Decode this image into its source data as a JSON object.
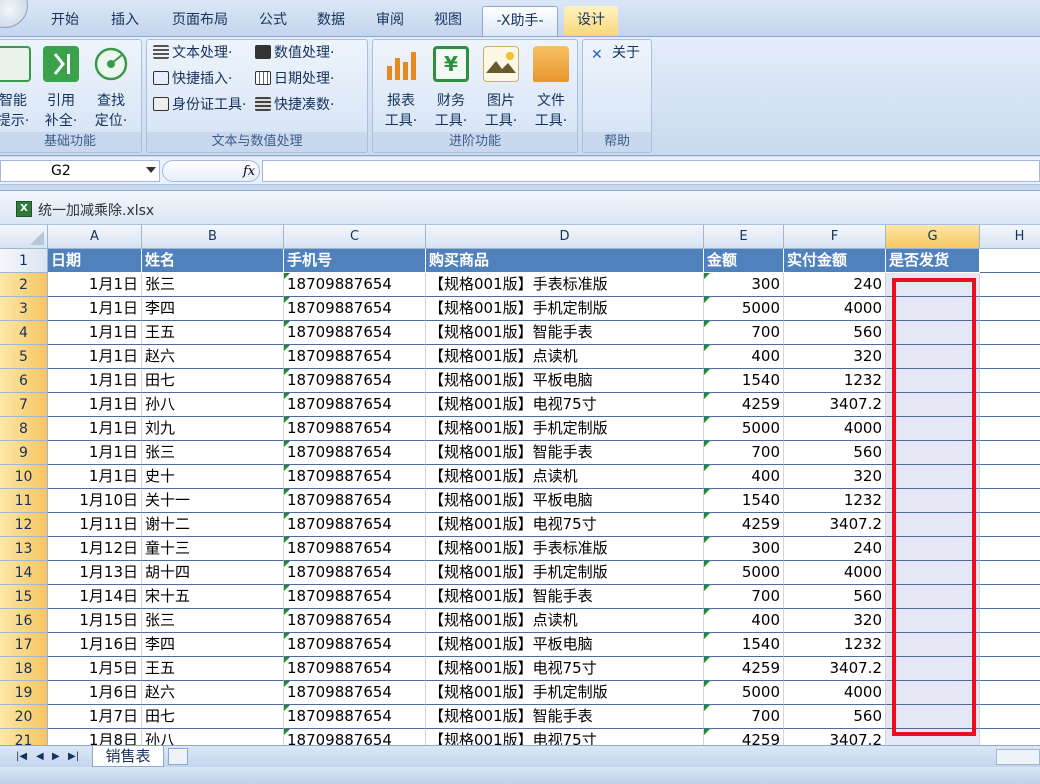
{
  "tabs": [
    "开始",
    "插入",
    "页面布局",
    "公式",
    "数据",
    "审阅",
    "视图",
    "-X助手-",
    "设计"
  ],
  "ribbon": {
    "groups": {
      "basic": "基础功能",
      "text_num": "文本与数值处理",
      "advanced": "进阶功能",
      "help": "帮助"
    },
    "basic_buttons": [
      {
        "l1": "智能",
        "l2": "提示·"
      },
      {
        "l1": "引用",
        "l2": "补全·"
      },
      {
        "l1": "查找",
        "l2": "定位·"
      }
    ],
    "text_buttons": [
      "文本处理·",
      "快捷插入·",
      "身份证工具·",
      "数值处理·",
      "日期处理·",
      "快捷凑数·"
    ],
    "adv_buttons": [
      {
        "l1": "报表",
        "l2": "工具·"
      },
      {
        "l1": "财务",
        "l2": "工具·"
      },
      {
        "l1": "图片",
        "l2": "工具·"
      },
      {
        "l1": "文件",
        "l2": "工具·"
      }
    ],
    "help_button": "关于"
  },
  "formula": {
    "namebox": "G2",
    "fx": "fx",
    "value": ""
  },
  "book": {
    "name": "统一加减乘除.xlsx"
  },
  "columns": [
    "A",
    "B",
    "C",
    "D",
    "E",
    "F",
    "G",
    "H"
  ],
  "headers": [
    "日期",
    "姓名",
    "手机号",
    "购买商品",
    "金额",
    "实付金额",
    "是否发货"
  ],
  "rows": [
    [
      "1月1日",
      "张三",
      "18709887654",
      "【规格001版】手表标准版",
      "300",
      "240"
    ],
    [
      "1月1日",
      "李四",
      "18709887654",
      "【规格001版】手机定制版",
      "5000",
      "4000"
    ],
    [
      "1月1日",
      "王五",
      "18709887654",
      "【规格001版】智能手表",
      "700",
      "560"
    ],
    [
      "1月1日",
      "赵六",
      "18709887654",
      "【规格001版】点读机",
      "400",
      "320"
    ],
    [
      "1月1日",
      "田七",
      "18709887654",
      "【规格001版】平板电脑",
      "1540",
      "1232"
    ],
    [
      "1月1日",
      "孙八",
      "18709887654",
      "【规格001版】电视75寸",
      "4259",
      "3407.2"
    ],
    [
      "1月1日",
      "刘九",
      "18709887654",
      "【规格001版】手机定制版",
      "5000",
      "4000"
    ],
    [
      "1月1日",
      "张三",
      "18709887654",
      "【规格001版】智能手表",
      "700",
      "560"
    ],
    [
      "1月1日",
      "史十",
      "18709887654",
      "【规格001版】点读机",
      "400",
      "320"
    ],
    [
      "1月10日",
      "关十一",
      "18709887654",
      "【规格001版】平板电脑",
      "1540",
      "1232"
    ],
    [
      "1月11日",
      "谢十二",
      "18709887654",
      "【规格001版】电视75寸",
      "4259",
      "3407.2"
    ],
    [
      "1月12日",
      "童十三",
      "18709887654",
      "【规格001版】手表标准版",
      "300",
      "240"
    ],
    [
      "1月13日",
      "胡十四",
      "18709887654",
      "【规格001版】手机定制版",
      "5000",
      "4000"
    ],
    [
      "1月14日",
      "宋十五",
      "18709887654",
      "【规格001版】智能手表",
      "700",
      "560"
    ],
    [
      "1月15日",
      "张三",
      "18709887654",
      "【规格001版】点读机",
      "400",
      "320"
    ],
    [
      "1月16日",
      "李四",
      "18709887654",
      "【规格001版】平板电脑",
      "1540",
      "1232"
    ],
    [
      "1月5日",
      "王五",
      "18709887654",
      "【规格001版】电视75寸",
      "4259",
      "3407.2"
    ],
    [
      "1月6日",
      "赵六",
      "18709887654",
      "【规格001版】手机定制版",
      "5000",
      "4000"
    ],
    [
      "1月7日",
      "田七",
      "18709887654",
      "【规格001版】智能手表",
      "700",
      "560"
    ],
    [
      "1月8日",
      "孙八",
      "18709887654",
      "【规格001版】电视75寸",
      "4259",
      "3407.2"
    ]
  ],
  "sheet": {
    "name": "销售表"
  }
}
